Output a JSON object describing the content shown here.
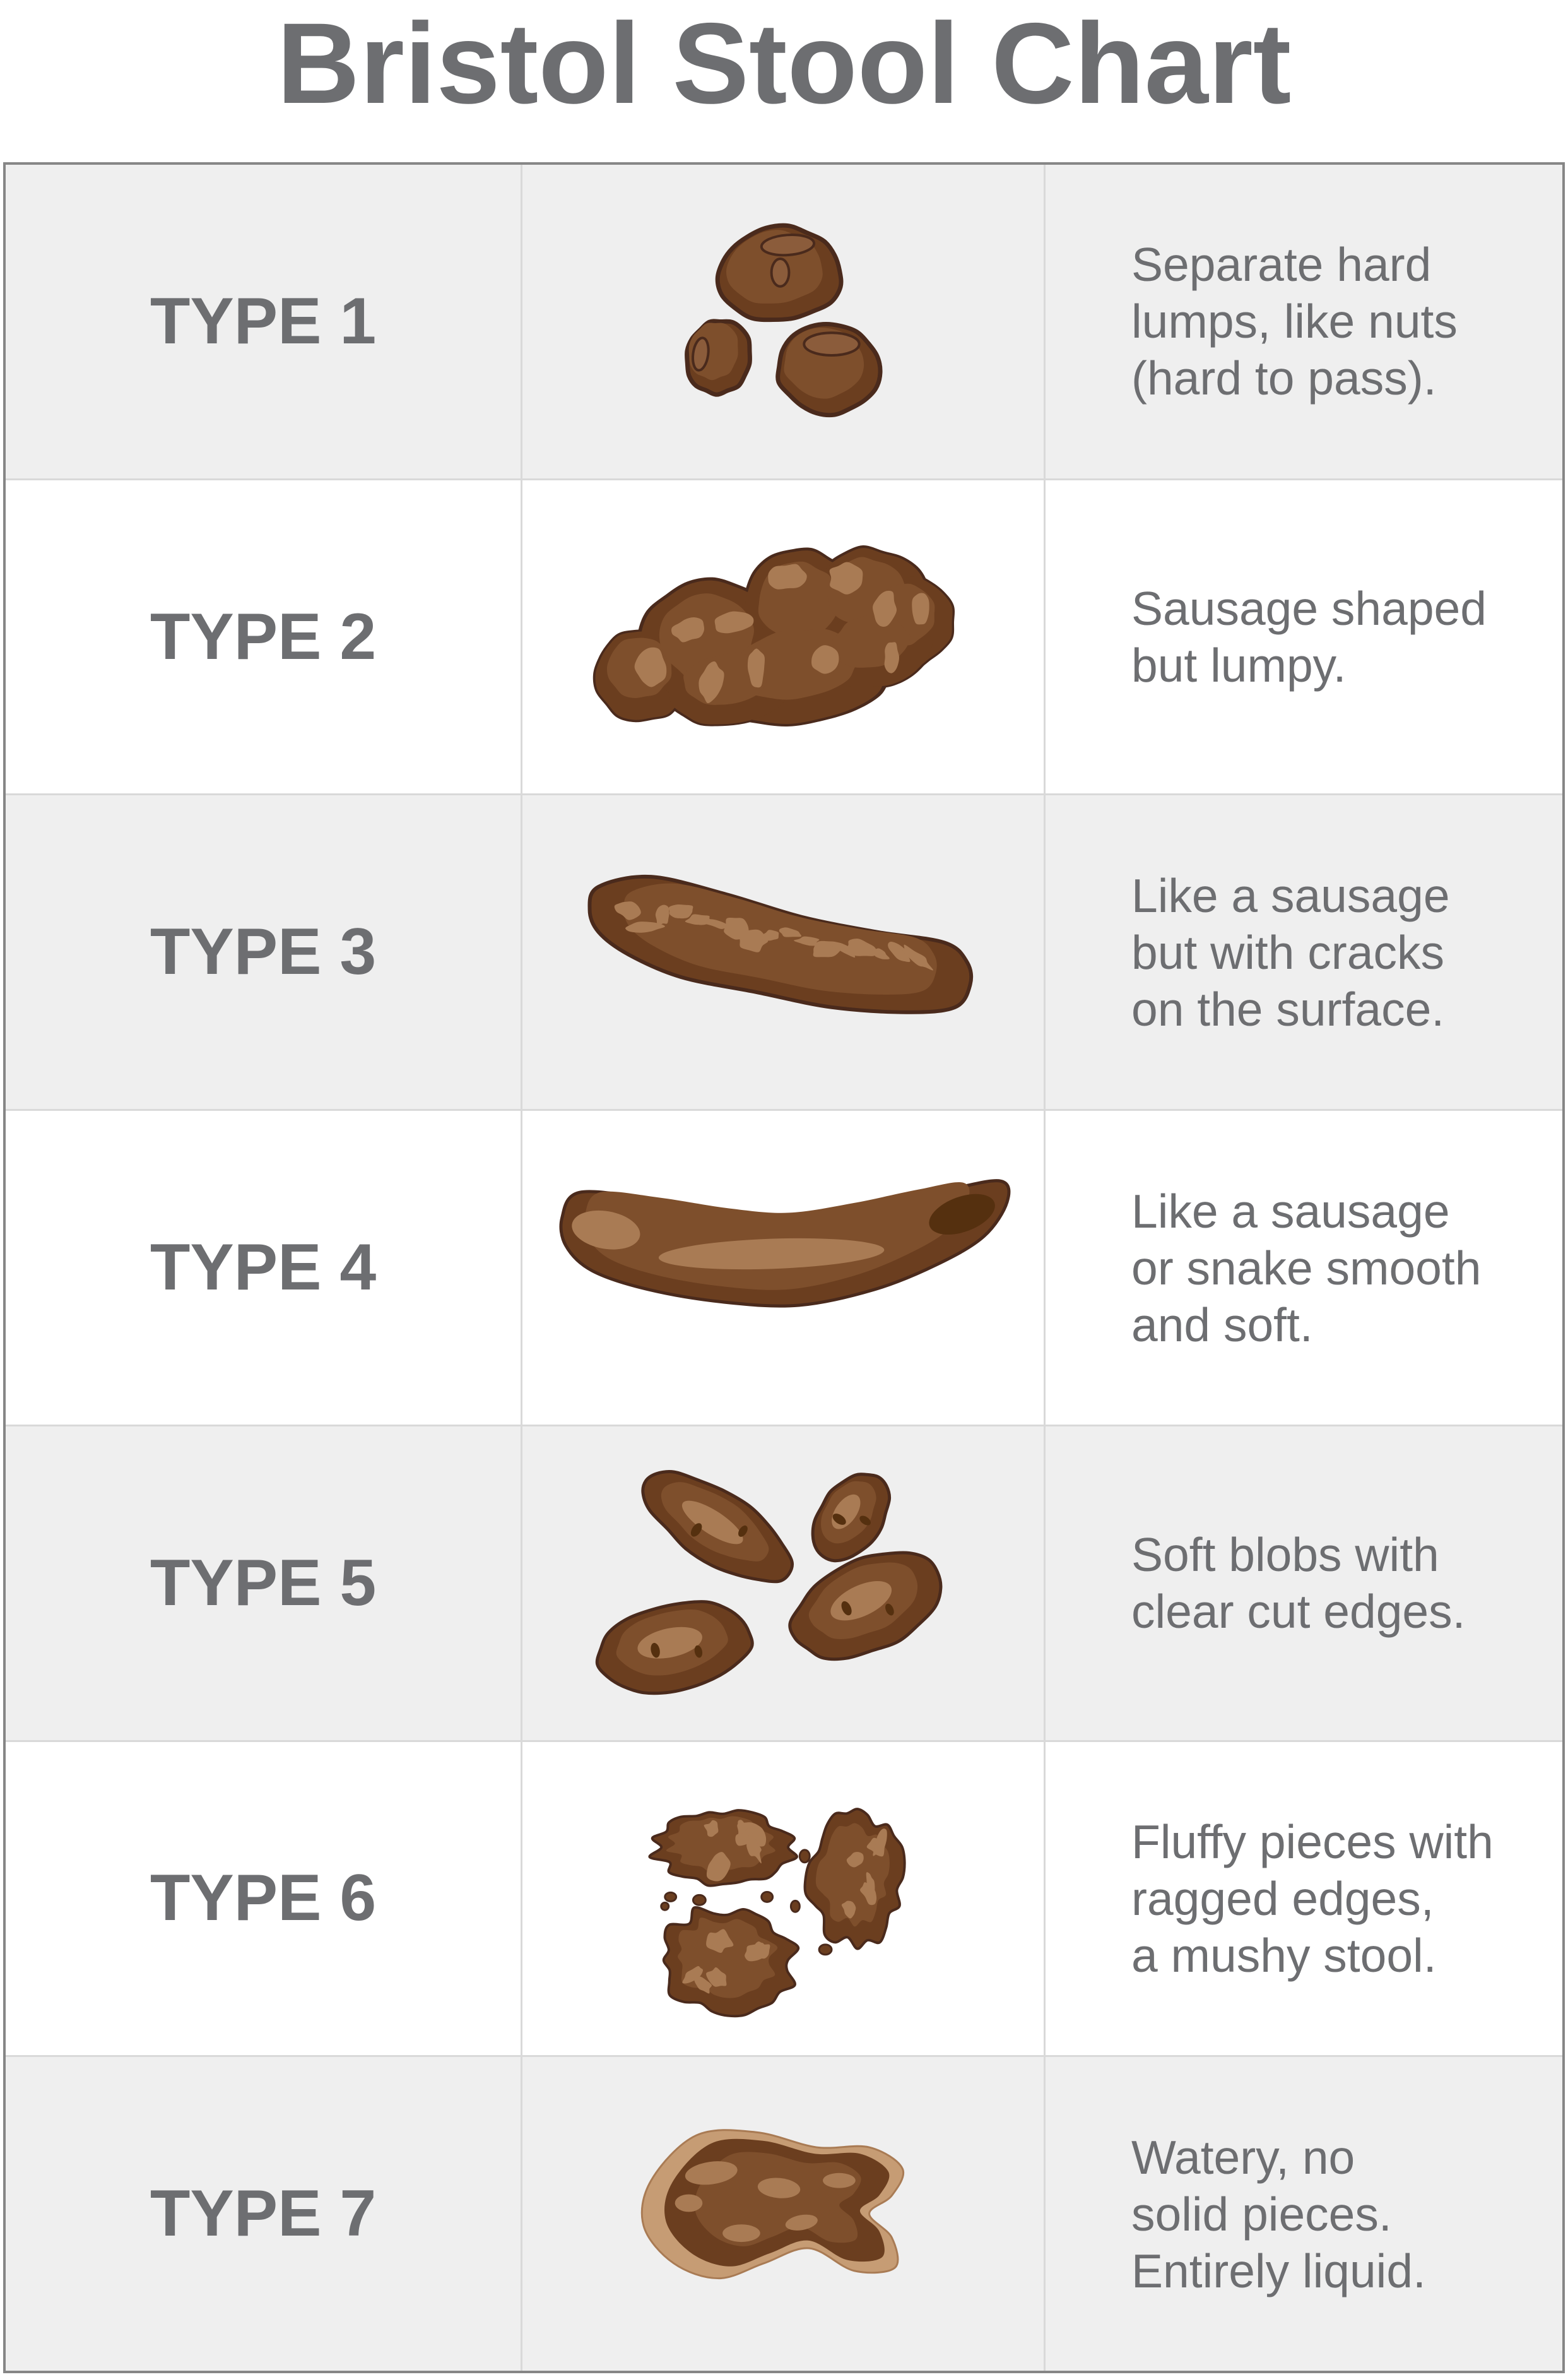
{
  "title": "Bristol Stool Chart",
  "rows": [
    {
      "type": "TYPE 1",
      "icon": "type-1-stool-illustration",
      "description": [
        "Separate hard",
        "lumps, like nuts",
        "(hard to pass)."
      ]
    },
    {
      "type": "TYPE 2",
      "icon": "type-2-stool-illustration",
      "description": [
        "Sausage shaped",
        "but lumpy."
      ]
    },
    {
      "type": "TYPE 3",
      "icon": "type-3-stool-illustration",
      "description": [
        "Like a sausage",
        "but with cracks",
        "on the surface."
      ]
    },
    {
      "type": "TYPE 4",
      "icon": "type-4-stool-illustration",
      "description": [
        "Like a sausage",
        "or snake smooth",
        "and soft."
      ]
    },
    {
      "type": "TYPE 5",
      "icon": "type-5-stool-illustration",
      "description": [
        "Soft blobs with",
        "clear cut edges."
      ]
    },
    {
      "type": "TYPE 6",
      "icon": "type-6-stool-illustration",
      "description": [
        "Fluffy pieces with",
        "ragged edges,",
        "a mushy stool."
      ]
    },
    {
      "type": "TYPE 7",
      "icon": "type-7-stool-illustration",
      "description": [
        "Watery, no",
        "solid pieces.",
        "Entirely liquid."
      ]
    }
  ],
  "colors": {
    "title_text": "#6d6e71",
    "type_label_text": "#6d6e71",
    "description_text": "#6d6e71",
    "row_shade": "#efefef",
    "outer_border": "#868686",
    "grid_line": "#d9d9d9",
    "stool_outline": "#4a2a1c",
    "stool_base": "#6b3e1f",
    "stool_mid": "#7e4f2c",
    "stool_highlight": "#a97b54",
    "stool_highlight_muted": "#8b5c3b",
    "stool_dark": "#55300f",
    "puddle_rim": "#c69c74"
  }
}
